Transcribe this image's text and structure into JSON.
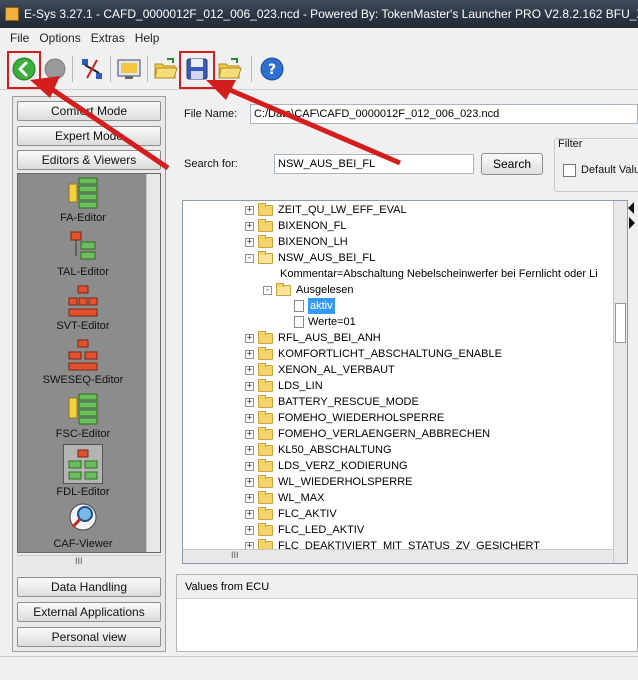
{
  "window": {
    "title": "E-Sys 3.27.1 - CAFD_0000012F_012_006_023.ncd - Powered By: TokenMaster's Launcher PRO V2.8.2.162 BFU_XOD"
  },
  "menu": [
    "File",
    "Options",
    "Extras",
    "Help"
  ],
  "toolbar": {
    "icons": [
      "back-arrow-icon",
      "stop-icon",
      "network-connect-icon",
      "monitor-icon",
      "open-folder-icon",
      "save-icon",
      "open-folder-icon",
      "help-icon"
    ]
  },
  "sidebar": {
    "modes": [
      "Comfort Mode",
      "Expert Mode",
      "Editors & Viewers"
    ],
    "editors": [
      "FA-Editor",
      "TAL-Editor",
      "SVT-Editor",
      "SWESEQ-Editor",
      "FSC-Editor",
      "FDL-Editor",
      "CAF-Viewer"
    ],
    "hscroll_label": "III",
    "bottom_buttons": [
      "Data Handling",
      "External Applications",
      "Personal view"
    ]
  },
  "main": {
    "file_name_label": "File Name:",
    "file_name_value": "C:/Data\\CAF\\CAFD_0000012F_012_006_023.ncd",
    "search_label": "Search for:",
    "search_value": "NSW_AUS_BEI_FL",
    "search_button": "Search",
    "filter_title": "Filter",
    "filter_checkbox_label": "Default Valu",
    "tree": [
      {
        "text": "ZEIT_QU_LW_EFF_EVAL",
        "level": 0,
        "type": "folder",
        "expand": "+"
      },
      {
        "text": "BIXENON_FL",
        "level": 0,
        "type": "folder",
        "expand": "+"
      },
      {
        "text": "BIXENON_LH",
        "level": 0,
        "type": "folder",
        "expand": "+"
      },
      {
        "text": "NSW_AUS_BEI_FL",
        "level": 0,
        "type": "folder-open",
        "expand": "-"
      },
      {
        "text": "Kommentar=Abschaltung Nebelscheinwerfer bei Fernlicht oder Li",
        "level": 1,
        "type": "text",
        "expand": ""
      },
      {
        "text": "Ausgelesen",
        "level": 1,
        "type": "folder-open",
        "expand": "-"
      },
      {
        "text": "aktiv",
        "level": 2,
        "type": "doc",
        "expand": "",
        "selected": true
      },
      {
        "text": "Werte=01",
        "level": 2,
        "type": "doc",
        "expand": ""
      },
      {
        "text": "RFL_AUS_BEI_ANH",
        "level": 0,
        "type": "folder",
        "expand": "+"
      },
      {
        "text": "KOMFORTLICHT_ABSCHALTUNG_ENABLE",
        "level": 0,
        "type": "folder",
        "expand": "+"
      },
      {
        "text": "XENON_AL_VERBAUT",
        "level": 0,
        "type": "folder",
        "expand": "+"
      },
      {
        "text": "LDS_LIN",
        "level": 0,
        "type": "folder",
        "expand": "+"
      },
      {
        "text": "BATTERY_RESCUE_MODE",
        "level": 0,
        "type": "folder",
        "expand": "+"
      },
      {
        "text": "FOMEHO_WIEDERHOLSPERRE",
        "level": 0,
        "type": "folder",
        "expand": "+"
      },
      {
        "text": "FOMEHO_VERLAENGERN_ABBRECHEN",
        "level": 0,
        "type": "folder",
        "expand": "+"
      },
      {
        "text": "KL50_ABSCHALTUNG",
        "level": 0,
        "type": "folder",
        "expand": "+"
      },
      {
        "text": "LDS_VERZ_KODIERUNG",
        "level": 0,
        "type": "folder",
        "expand": "+"
      },
      {
        "text": "WL_WIEDERHOLSPERRE",
        "level": 0,
        "type": "folder",
        "expand": "+"
      },
      {
        "text": "WL_MAX",
        "level": 0,
        "type": "folder",
        "expand": "+"
      },
      {
        "text": "FLC_AKTIV",
        "level": 0,
        "type": "folder",
        "expand": "+"
      },
      {
        "text": "FLC_LED_AKTIV",
        "level": 0,
        "type": "folder",
        "expand": "+"
      },
      {
        "text": "FLC_DEAKTIVIERT_MIT_STATUS_ZV_GESICHERT",
        "level": 0,
        "type": "folder",
        "expand": "+"
      }
    ],
    "tree_hscroll_label": "III",
    "values_title": "Values from ECU"
  },
  "colors": {
    "annotation_red": "#d41e1e",
    "selection_blue": "#3399ff"
  }
}
